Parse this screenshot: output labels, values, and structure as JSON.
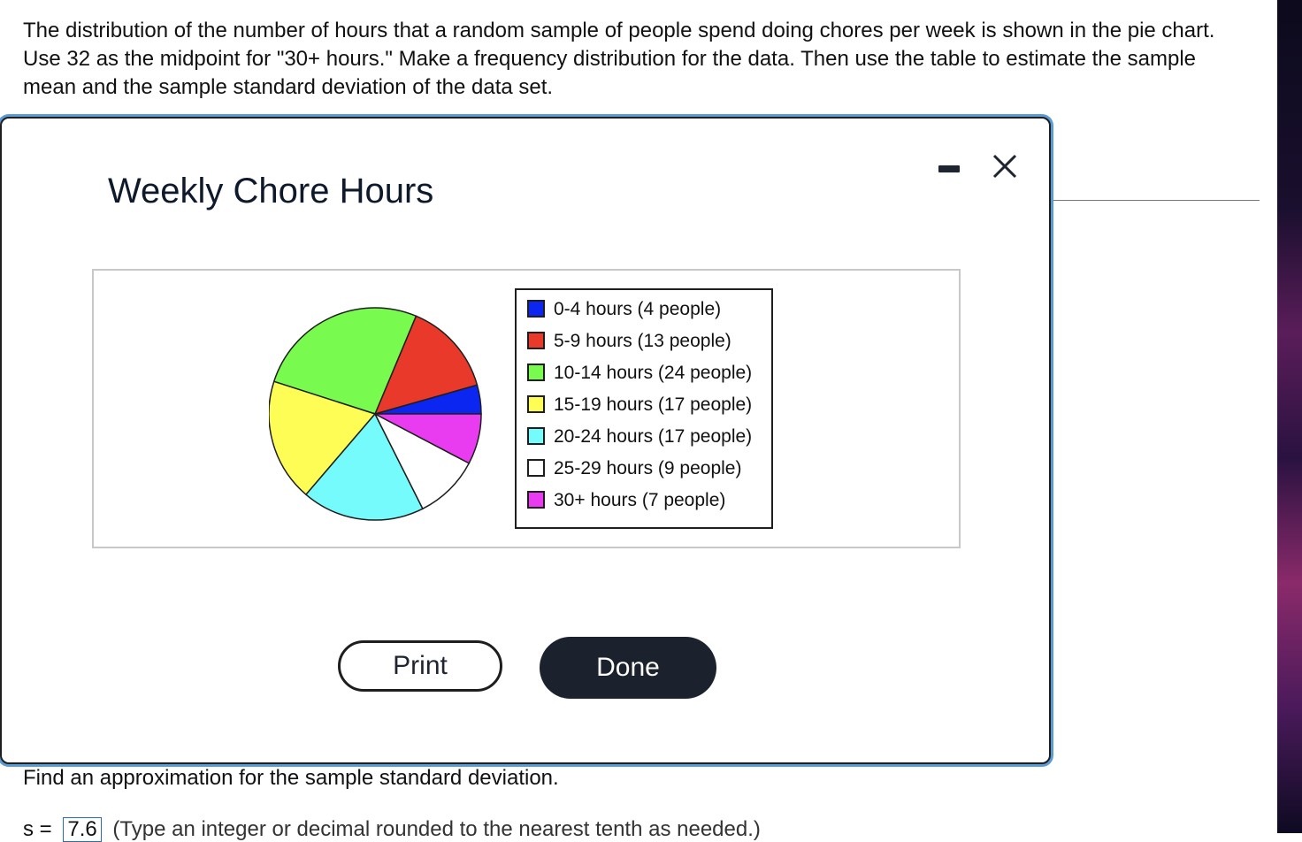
{
  "question": {
    "text": "The distribution of the number of hours that a random sample of people spend doing chores per week is shown in the pie chart. Use 32 as the midpoint for \"30+ hours.\" Make a frequency distribution for the data. Then use the table to estimate the sample mean and the sample standard deviation of the data set."
  },
  "modal": {
    "title": "Weekly Chore Hours",
    "print_label": "Print",
    "done_label": "Done"
  },
  "chart_data": {
    "type": "pie",
    "title": "Weekly Chore Hours",
    "categories": [
      "0-4 hours",
      "5-9 hours",
      "10-14 hours",
      "15-19 hours",
      "20-24 hours",
      "25-29 hours",
      "30+ hours"
    ],
    "values": [
      4,
      13,
      24,
      17,
      17,
      9,
      7
    ],
    "colors": [
      "#0a26f0",
      "#e8392a",
      "#79fa4f",
      "#fdfd55",
      "#76fbfd",
      "#ffffff",
      "#e93cf0"
    ],
    "legend_labels": [
      "0-4 hours (4 people)",
      "5-9 hours (13 people)",
      "10-14 hours (24 people)",
      "15-19 hours (17 people)",
      "20-24 hours (17 people)",
      "25-29 hours (9 people)",
      "30+ hours (7 people)"
    ],
    "legend_position": "right"
  },
  "bottom": {
    "prompt": "Find an approximation for the sample standard deviation.",
    "answer_prefix": "s =",
    "answer_value": "7.6",
    "answer_hint": "(Type an integer or decimal rounded to the nearest tenth as needed.)"
  }
}
